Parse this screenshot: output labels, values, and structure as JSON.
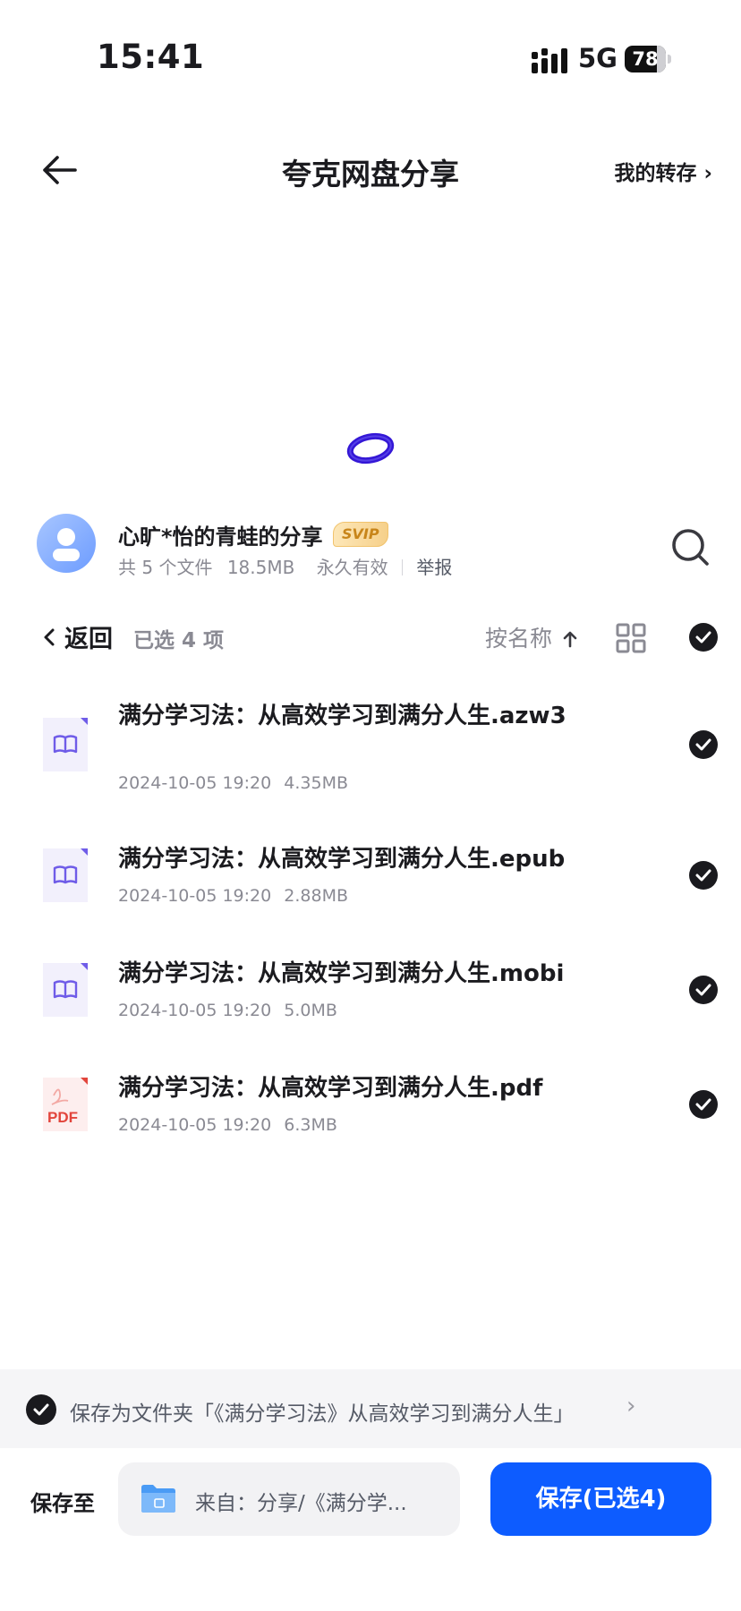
{
  "status_bar": {
    "time": "15:41",
    "network": "5G",
    "battery": "78",
    "battery_level": 0.78
  },
  "nav": {
    "title": "夸克网盘分享",
    "my_transfer": "我的转存 ›"
  },
  "share": {
    "name": "心旷*怡的青蛙的分享",
    "badge": "SVIP",
    "file_count": "共 5 个文件",
    "size": "18.5MB",
    "validity": "永久有效",
    "report": "举报"
  },
  "toolbar": {
    "back_label": "返回",
    "selected": "已选 4 项",
    "sort_label": "按名称"
  },
  "files": [
    {
      "name": "满分学习法：从高效学习到满分人生.azw3",
      "date": "2024-10-05 19:20",
      "size": "4.35MB",
      "type": "ebook-icon"
    },
    {
      "name": "满分学习法：从高效学习到满分人生.epub",
      "date": "2024-10-05 19:20",
      "size": "2.88MB",
      "type": "ebook-icon"
    },
    {
      "name": "满分学习法：从高效学习到满分人生.mobi",
      "date": "2024-10-05 19:20",
      "size": "5.0MB",
      "type": "ebook-icon"
    },
    {
      "name": "满分学习法：从高效学习到满分人生.pdf",
      "date": "2024-10-05 19:20",
      "size": "6.3MB",
      "type": "pdf-icon"
    }
  ],
  "save_as": {
    "label": "保存为文件夹「《满分学习法》从高效学习到满分人生」",
    "chevron": "›"
  },
  "bottom": {
    "save_to_label": "保存至",
    "destination": "来自：分享/《满分学...",
    "save_button": "保存(已选4)"
  },
  "colors": {
    "primary": "#0d5cff",
    "check": "#1a1a1e",
    "meta_text": "#8a8a93"
  }
}
